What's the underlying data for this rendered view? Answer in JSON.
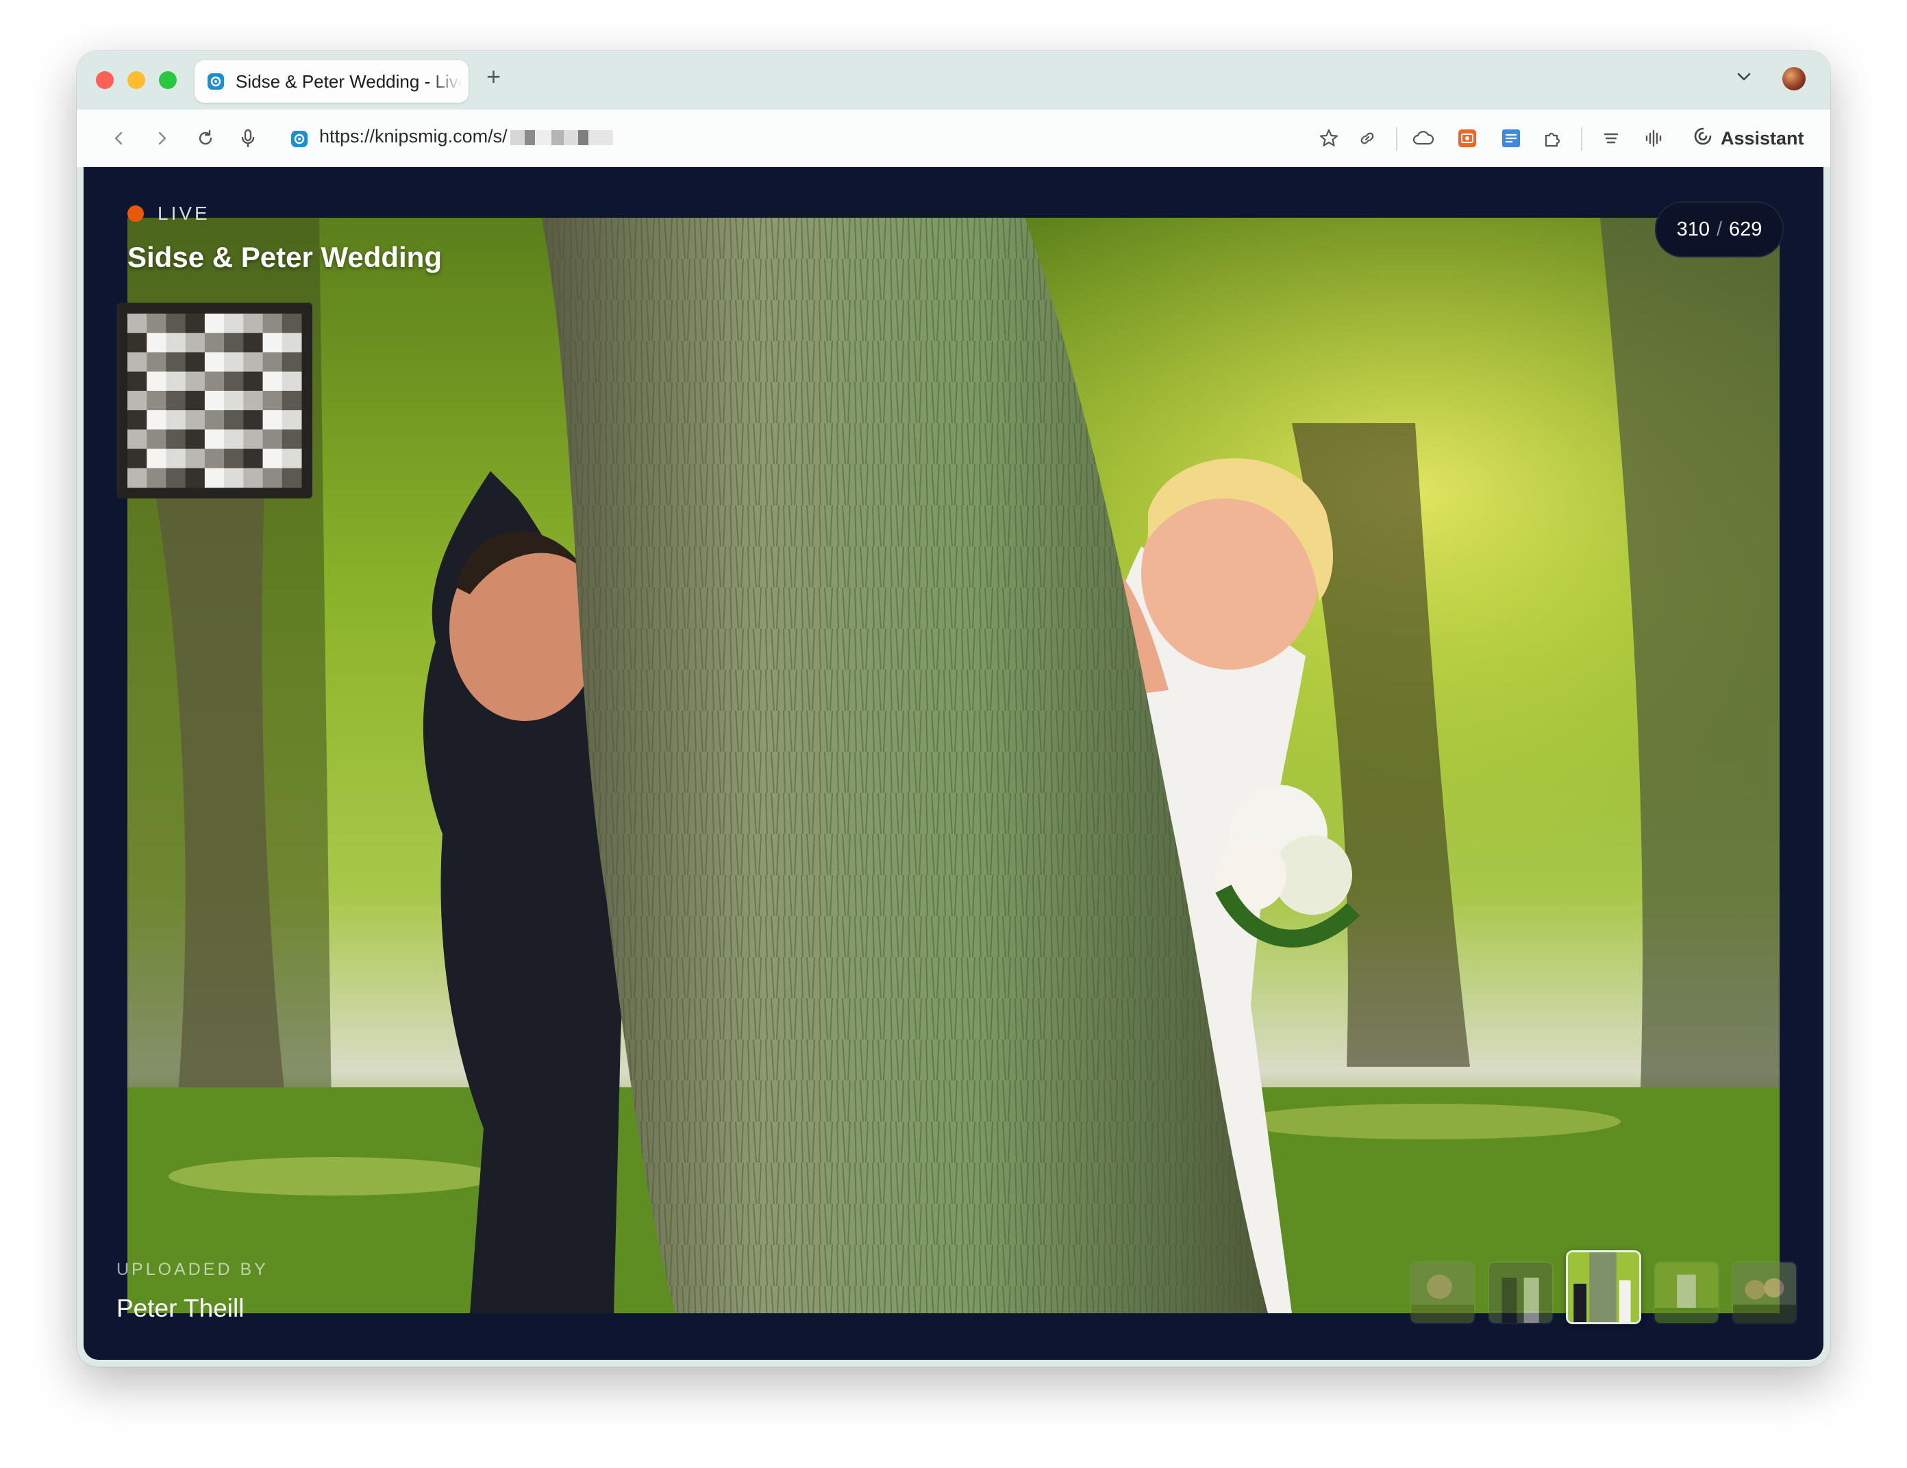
{
  "browser": {
    "tab": {
      "title": "Sidse & Peter Wedding - Live"
    },
    "address_bar": {
      "url": "https://knipsmig.com/s/"
    },
    "assistant_label": "Assistant"
  },
  "event": {
    "live_label": "LIVE",
    "title": "Sidse & Peter Wedding",
    "counter": {
      "current": "310",
      "total": "629"
    },
    "uploaded_by_label": "UPLOADED BY",
    "uploader_name": "Peter Theill",
    "thumbnails": [
      {
        "name": "thumbnail-1",
        "active": false
      },
      {
        "name": "thumbnail-2",
        "active": false
      },
      {
        "name": "thumbnail-3",
        "active": true
      },
      {
        "name": "thumbnail-4",
        "active": false
      },
      {
        "name": "thumbnail-5",
        "active": false
      }
    ]
  },
  "colors": {
    "page_background": "#0d1530",
    "live_dot": "#e8590c",
    "accent": "#1b8fd0"
  }
}
